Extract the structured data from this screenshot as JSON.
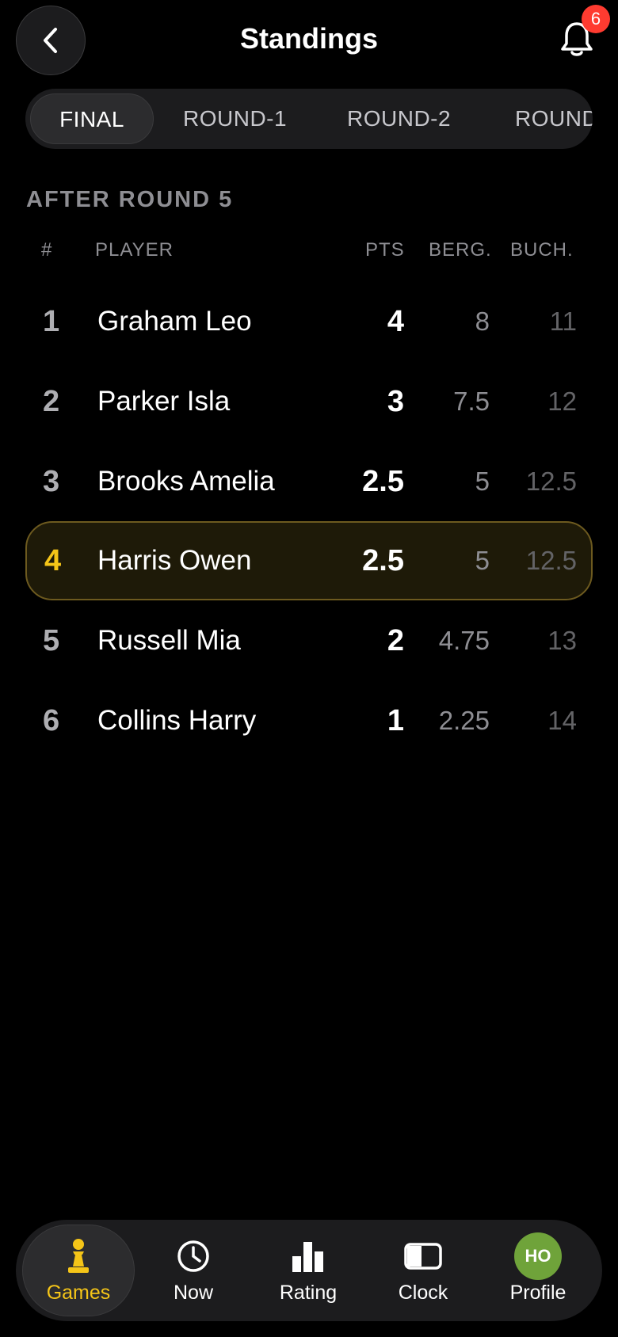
{
  "header": {
    "title": "Standings",
    "notifications_count": "6"
  },
  "tabs": [
    {
      "label": "FINAL"
    },
    {
      "label": "ROUND-1"
    },
    {
      "label": "ROUND-2"
    },
    {
      "label": "ROUND"
    }
  ],
  "section_label": "AFTER ROUND 5",
  "columns": {
    "rank": "#",
    "player": "PLAYER",
    "pts": "PTS",
    "berg": "BERG.",
    "buch": "BUCH."
  },
  "rows": [
    {
      "rank": "1",
      "name": "Graham Leo",
      "pts": "4",
      "berg": "8",
      "buch": "11"
    },
    {
      "rank": "2",
      "name": "Parker Isla",
      "pts": "3",
      "berg": "7.5",
      "buch": "12"
    },
    {
      "rank": "3",
      "name": "Brooks Amelia",
      "pts": "2.5",
      "berg": "5",
      "buch": "12.5"
    },
    {
      "rank": "4",
      "name": "Harris Owen",
      "pts": "2.5",
      "berg": "5",
      "buch": "12.5"
    },
    {
      "rank": "5",
      "name": "Russell Mia",
      "pts": "2",
      "berg": "4.75",
      "buch": "13"
    },
    {
      "rank": "6",
      "name": "Collins Harry",
      "pts": "1",
      "berg": "2.25",
      "buch": "14"
    }
  ],
  "nav": [
    {
      "label": "Games",
      "icon": "pawn-icon"
    },
    {
      "label": "Now",
      "icon": "clock-icon"
    },
    {
      "label": "Rating",
      "icon": "bar-chart-icon"
    },
    {
      "label": "Clock",
      "icon": "chess-clock-icon"
    },
    {
      "label": "Profile",
      "icon": "avatar",
      "initials": "HO"
    }
  ],
  "colors": {
    "accent": "#f5c518",
    "badge": "#ff3b30",
    "avatar": "#6fa33a",
    "highlight_border": "#6d5a1f"
  }
}
